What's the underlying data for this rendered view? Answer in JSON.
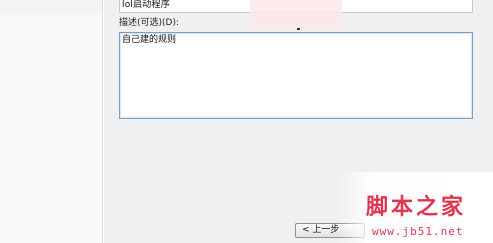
{
  "task_name": {
    "value": "lol启动程序"
  },
  "description": {
    "label": "描述(可选)(D):",
    "value": "自己建的规则"
  },
  "footer": {
    "back_button_label": "< 上一步"
  },
  "watermark": {
    "title": "脚本之家",
    "url": "www.jb51.net",
    "color": "#e0354f"
  }
}
